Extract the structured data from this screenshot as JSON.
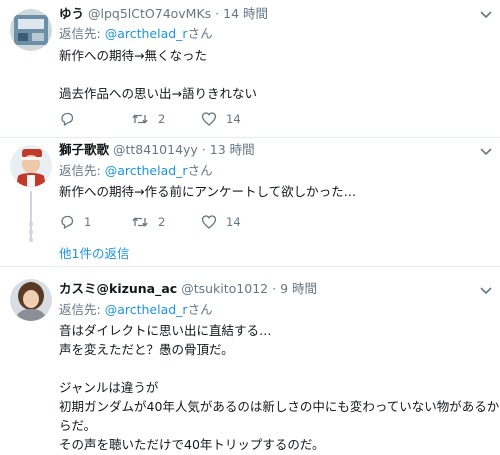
{
  "tweets": [
    {
      "name": "ゆう",
      "handle": "@lpq5lCtO74ovMKs",
      "sep": "·",
      "time": "14 時間",
      "reply_prefix": "返信先: ",
      "reply_handle": "@arcthelad_r",
      "reply_suffix": "さん",
      "text": "新作への期待→無くなった\n\n過去作品への思い出→語りきれない",
      "replies": "",
      "retweets": "2",
      "likes": "14"
    },
    {
      "name": "獅子歌歌",
      "handle": "@tt841014yy",
      "sep": "·",
      "time": "13 時間",
      "reply_prefix": "返信先: ",
      "reply_handle": "@arcthelad_r",
      "reply_suffix": "さん",
      "text": "新作への期待→作る前にアンケートして欲しかった…",
      "replies": "1",
      "retweets": "2",
      "likes": "14",
      "more_replies": "他1件の返信"
    },
    {
      "name": "カスミ@kizuna_ac",
      "handle": "@tsukito1012",
      "sep": "·",
      "time": "9 時間",
      "reply_prefix": "返信先: ",
      "reply_handle": "@arcthelad_r",
      "reply_suffix": "さん",
      "text": "音はダイレクトに思い出に直結する…\n声を変えただと？愚の骨頂だ。\n\nジャンルは違うが\n初期ガンダムが40年人気があるのは新しさの中にも変わっていない物があるか\nらだ。\nその声を聴いただけで40年トリップするのだ。"
    }
  ],
  "icons": {
    "reply": "reply-icon",
    "retweet": "retweet-icon",
    "like": "heart-icon",
    "caret": "chevron-down-icon"
  },
  "colors": {
    "link": "#1b95e0",
    "muted": "#657786",
    "divider": "#e6ecf0"
  }
}
